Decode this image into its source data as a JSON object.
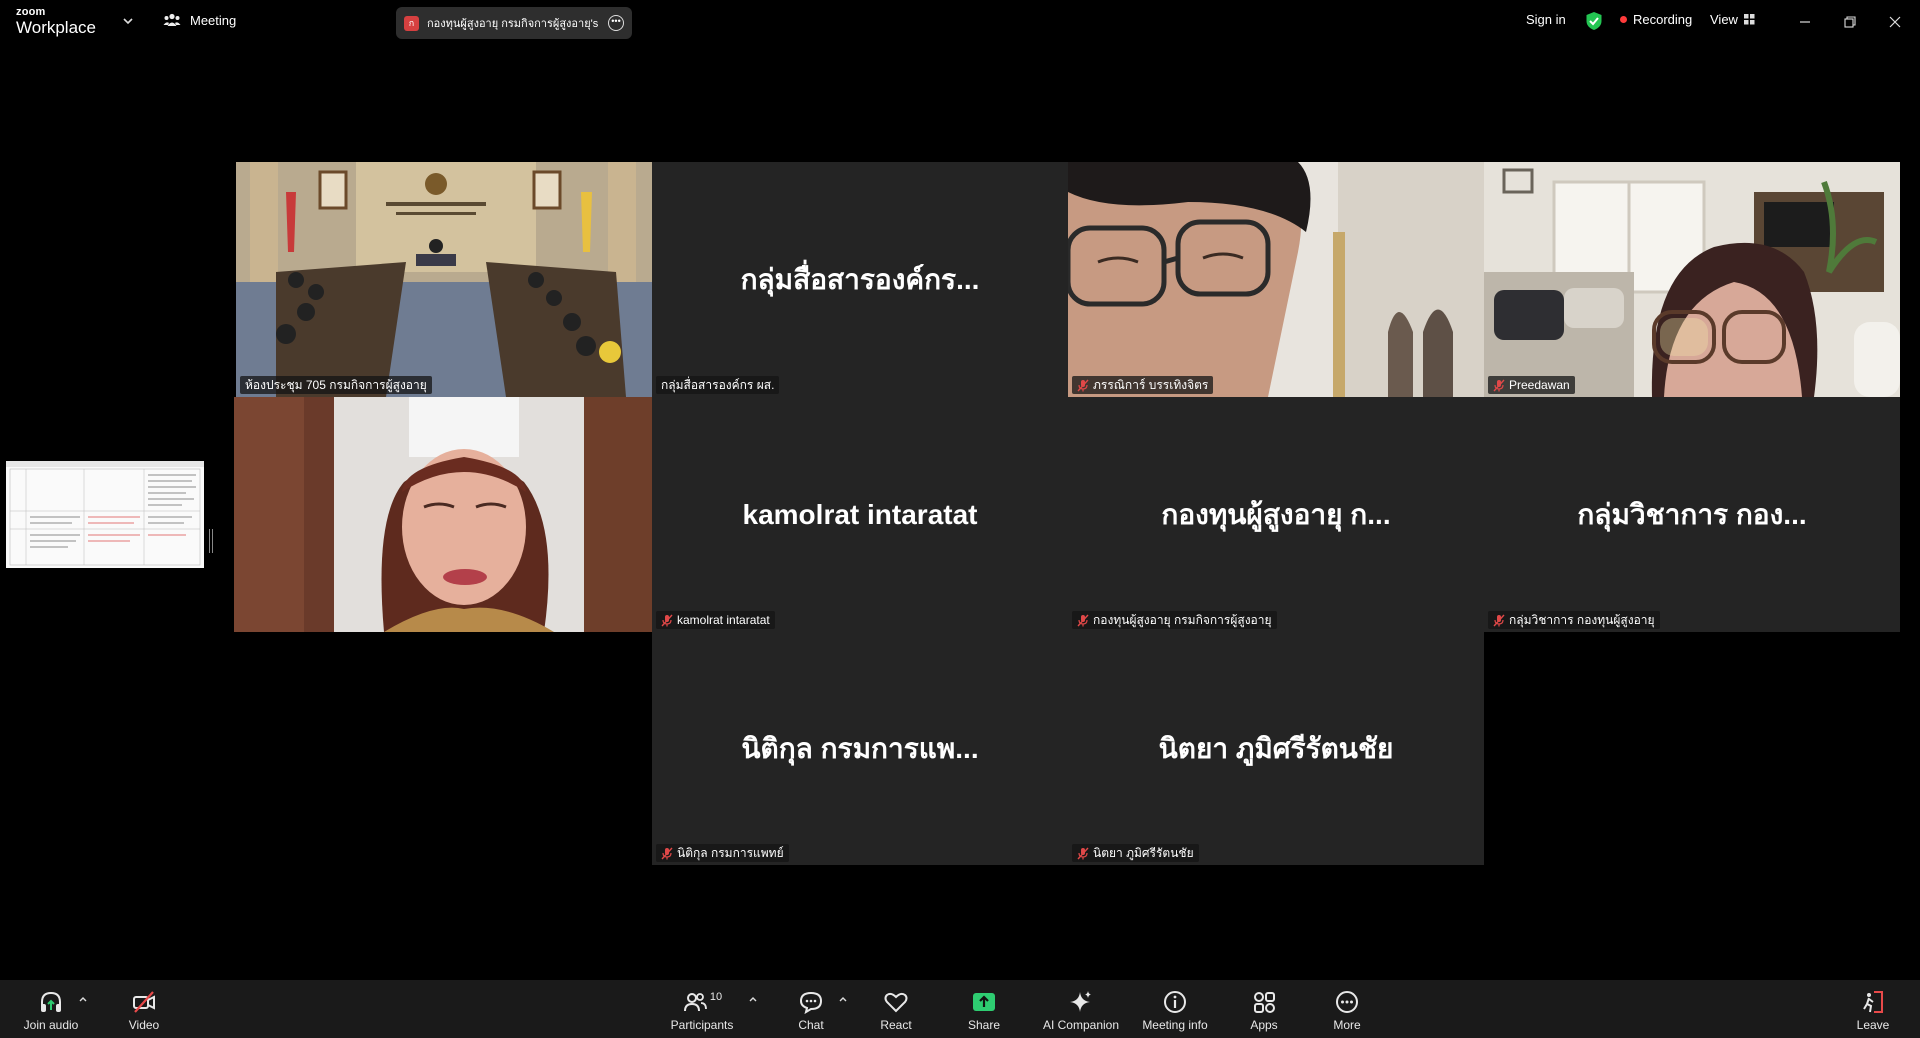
{
  "app": {
    "logo_small": "zoom",
    "logo_big": "Workplace",
    "meeting_menu_label": "Meeting",
    "meeting_title_badge": "ก",
    "meeting_title": "กองทุนผู้สูงอายุ กรมกิจการผู้สูงอายุ's zo"
  },
  "topbar_right": {
    "sign_in": "Sign in",
    "recording": "Recording",
    "view": "View"
  },
  "colors": {
    "active_speaker": "#2ecc71",
    "muted_icon": "#e04848",
    "recording_dot": "#ff3b3b",
    "share_green": "#2ecc71",
    "tile_bg": "#242424"
  },
  "tiles": [
    {
      "name": "ห้องประชุม 705 กรมกิจการผู้สูงอายุ",
      "display": "",
      "video": "room",
      "muted": false,
      "active": true
    },
    {
      "name": "กลุ่มสื่อสารองค์กร ผส.",
      "display": "กลุ่มสื่อสารองค์กร...",
      "video": "none",
      "muted": false
    },
    {
      "name": "ภรรณิการ์ บรรเทิงจิตร",
      "display": "",
      "video": "man",
      "muted": true
    },
    {
      "name": "Preedawan",
      "display": "",
      "video": "woman-home",
      "muted": true
    },
    {
      "name": "",
      "display": "",
      "video": "woman-office",
      "muted": false
    },
    {
      "name": "kamolrat intaratat",
      "display": "kamolrat intaratat",
      "video": "none",
      "muted": true
    },
    {
      "name": "กองทุนผู้สูงอายุ กรมกิจการผู้สูงอายุ",
      "display": "กองทุนผู้สูงอายุ ก...",
      "video": "none",
      "muted": true
    },
    {
      "name": "กลุ่มวิชาการ กองทุนผู้สูงอายุ",
      "display": "กลุ่มวิชาการ กอง...",
      "video": "none",
      "muted": true
    },
    {
      "name": "นิติกุล กรมการแพทย์",
      "display": "นิติกุล กรมการแพ...",
      "video": "none",
      "muted": true
    },
    {
      "name": "นิตยา ภูมิศรีรัตนชัย",
      "display": "นิตยา ภูมิศรีรัตนชัย",
      "video": "none",
      "muted": true
    }
  ],
  "toolbar": {
    "join_audio": "Join audio",
    "video": "Video",
    "participants": "Participants",
    "participants_count": "10",
    "chat": "Chat",
    "react": "React",
    "share": "Share",
    "ai_companion": "AI Companion",
    "meeting_info": "Meeting info",
    "apps": "Apps",
    "more": "More",
    "leave": "Leave"
  }
}
